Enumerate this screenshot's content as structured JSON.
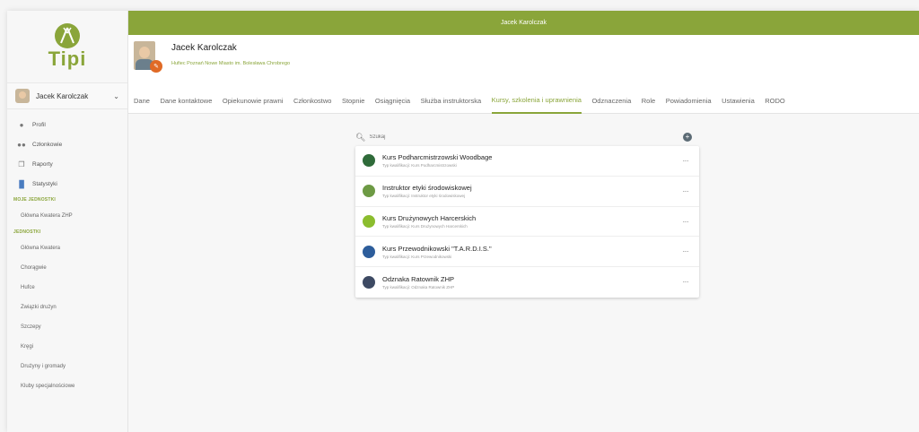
{
  "app": {
    "logo_text": "Tipi",
    "accent": "#8aa53a",
    "topbar_title": "Jacek Karolczak"
  },
  "sidebar": {
    "user_name": "Jacek Karolczak",
    "nav": [
      {
        "label": "Profil",
        "icon": "person-icon"
      },
      {
        "label": "Członkowie",
        "icon": "people-icon"
      },
      {
        "label": "Raporty",
        "icon": "reports-icon"
      },
      {
        "label": "Statystyki",
        "icon": "stats-icon"
      }
    ],
    "section_own": "MOJE JEDNOSTKI",
    "own_units": [
      "Główna Kwatera ZHP"
    ],
    "section_units": "JEDNOSTKI",
    "units": [
      "Główna Kwatera",
      "Chorągwie",
      "Hufce",
      "Związki drużyn",
      "Szczepy",
      "Kręgi",
      "Drużyny i gromady",
      "Kluby specjalnościowe"
    ]
  },
  "profile": {
    "name": "Jacek Karolczak",
    "unit": "Hufiec Poznań Nowe Miasto im. Bolesława Chrobrego"
  },
  "tabs": [
    {
      "label": "Dane",
      "active": false
    },
    {
      "label": "Dane kontaktowe",
      "active": false
    },
    {
      "label": "Opiekunowie prawni",
      "active": false
    },
    {
      "label": "Członkostwo",
      "active": false
    },
    {
      "label": "Stopnie",
      "active": false
    },
    {
      "label": "Osiągnięcia",
      "active": false
    },
    {
      "label": "Służba instruktorska",
      "active": false
    },
    {
      "label": "Kursy, szkolenia i uprawnienia",
      "active": true
    },
    {
      "label": "Odznaczenia",
      "active": false
    },
    {
      "label": "Role",
      "active": false
    },
    {
      "label": "Powiadomienia",
      "active": false
    },
    {
      "label": "Ustawienia",
      "active": false
    },
    {
      "label": "RODO",
      "active": false
    }
  ],
  "search": {
    "placeholder": "Szukaj"
  },
  "courses": [
    {
      "title": "Kurs Podharcmistrzowski Woodbage",
      "type": "Typ kwalifikacji: Kurs Podharcmistrzowski",
      "color": "#2f6b3a"
    },
    {
      "title": "Instruktor etyki środowiskowej",
      "type": "Typ kwalifikacji: Instruktor etyki środowiskowej",
      "color": "#6d9a44"
    },
    {
      "title": "Kurs Drużynowych Harcerskich",
      "type": "Typ kwalifikacji: Kurs Drużynowych Harcerskich",
      "color": "#8bbd2e"
    },
    {
      "title": "Kurs Przewodnikowski \"T.A.R.D.I.S.\"",
      "type": "Typ kwalifikacji: Kurs Przewodnikowski",
      "color": "#2d5d9b"
    },
    {
      "title": "Odznaka Ratownik ZHP",
      "type": "Typ kwalifikacji: Odznaka Ratownik ZHP",
      "color": "#3d4a63"
    }
  ],
  "more_label": "···",
  "add_label": "+"
}
